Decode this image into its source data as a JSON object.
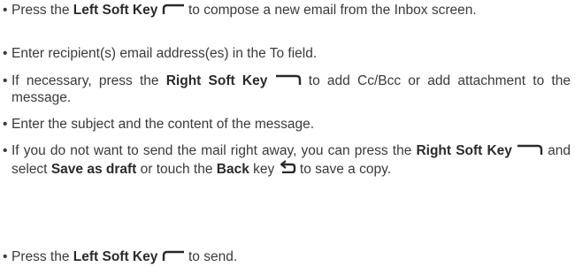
{
  "bullet_char": "•",
  "items": [
    {
      "pre": "Press the ",
      "bold": "Left Soft Key",
      "post": " to compose a new email from the Inbox screen.",
      "icon": "left-soft-key-icon"
    },
    {
      "text": "Enter recipient(s) email address(es) in the To field."
    },
    {
      "pre": "If necessary, press the ",
      "bold": "Right Soft Key",
      "post": " to add Cc/Bcc or add attachment to the message.",
      "icon": "right-soft-key-icon"
    },
    {
      "text": "Enter the subject and the content of the message."
    },
    {
      "pre": "If you do not want to send the mail right away, you can press the ",
      "bold1": "Right Soft Key",
      "mid1": " and select ",
      "bold2": "Save as draft",
      "mid2": " or touch the ",
      "bold3": "Back",
      "mid3": " key ",
      "post": " to save a copy.",
      "icons": [
        "right-soft-key-icon",
        "back-key-icon"
      ]
    },
    {
      "pre": "Press the ",
      "bold": "Left Soft Key",
      "post": " to send.",
      "icon": "left-soft-key-icon"
    }
  ],
  "colors": {
    "text": "#3a3a3a",
    "icon": "#2a2a2a"
  }
}
